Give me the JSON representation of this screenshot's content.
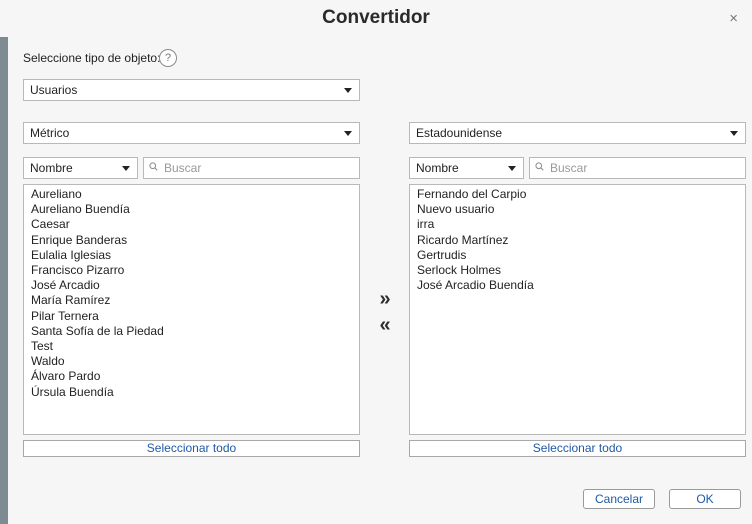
{
  "dialog": {
    "title": "Convertidor",
    "close": "×"
  },
  "object_type": {
    "label": "Seleccione tipo de objeto:",
    "help": "?",
    "selected": "Usuarios"
  },
  "left": {
    "system": "Métrico",
    "filter_field": "Nombre",
    "search_placeholder": "Buscar",
    "items": [
      "Aureliano",
      "Aureliano Buendía",
      "Caesar",
      "Enrique Banderas",
      "Eulalia Iglesias",
      "Francisco Pizarro",
      "José Arcadio",
      "María Ramírez",
      "Pilar Ternera",
      "Santa Sofía de la Piedad",
      "Test",
      "Waldo",
      "Álvaro Pardo",
      "Úrsula Buendía"
    ],
    "select_all": "Seleccionar todo"
  },
  "right": {
    "system": "Estadounidense",
    "filter_field": "Nombre",
    "search_placeholder": "Buscar",
    "items": [
      "Fernando del Carpio",
      "Nuevo usuario",
      "irra",
      "Ricardo Martínez",
      "Gertrudis",
      "Serlock Holmes",
      "José Arcadio Buendía"
    ],
    "select_all": "Seleccionar todo"
  },
  "transfer": {
    "move_right": "»",
    "move_left": "«"
  },
  "footer": {
    "cancel": "Cancelar",
    "ok": "OK"
  }
}
